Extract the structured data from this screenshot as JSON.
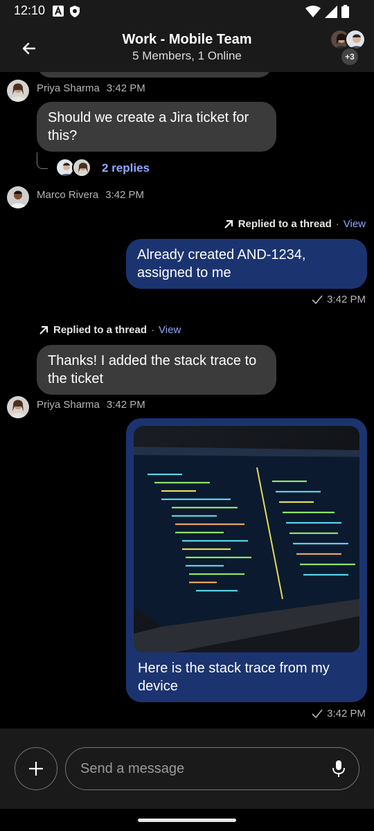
{
  "status_bar": {
    "time": "12:10",
    "left_icons": [
      "a-box-icon",
      "shield-icon"
    ],
    "right_icons": [
      "wifi-icon",
      "cell-signal-icon",
      "battery-icon"
    ]
  },
  "header": {
    "title": "Work - Mobile Team",
    "subtitle": "5 Members, 1 Online",
    "extra_members_badge": "+3"
  },
  "messages": [
    {
      "sender": "Priya Sharma",
      "time": "3:42 PM",
      "text": "Should we create a Jira ticket for this?",
      "replies_label": "2 replies"
    },
    {
      "sender": "Marco Rivera",
      "time": "3:42 PM"
    },
    {
      "outgoing": true,
      "thread_label": "Replied to a thread",
      "thread_view": "View",
      "text": "Already created AND-1234, assigned to me",
      "time": "3:42 PM"
    },
    {
      "thread_label": "Replied to a thread",
      "thread_view": "View",
      "text": "Thanks! I added the stack trace to the ticket",
      "sender": "Priya Sharma",
      "time": "3:42 PM"
    },
    {
      "outgoing": true,
      "attachment": "image",
      "text": "Here is the stack trace from my device",
      "time": "3:42 PM"
    }
  ],
  "composer": {
    "placeholder": "Send a message"
  },
  "colors": {
    "incoming_bubble": "#3b3b3b",
    "outgoing_bubble": "#1b3470",
    "link": "#8fa9ff",
    "background": "#000000",
    "bars": "#1a1a1a"
  }
}
